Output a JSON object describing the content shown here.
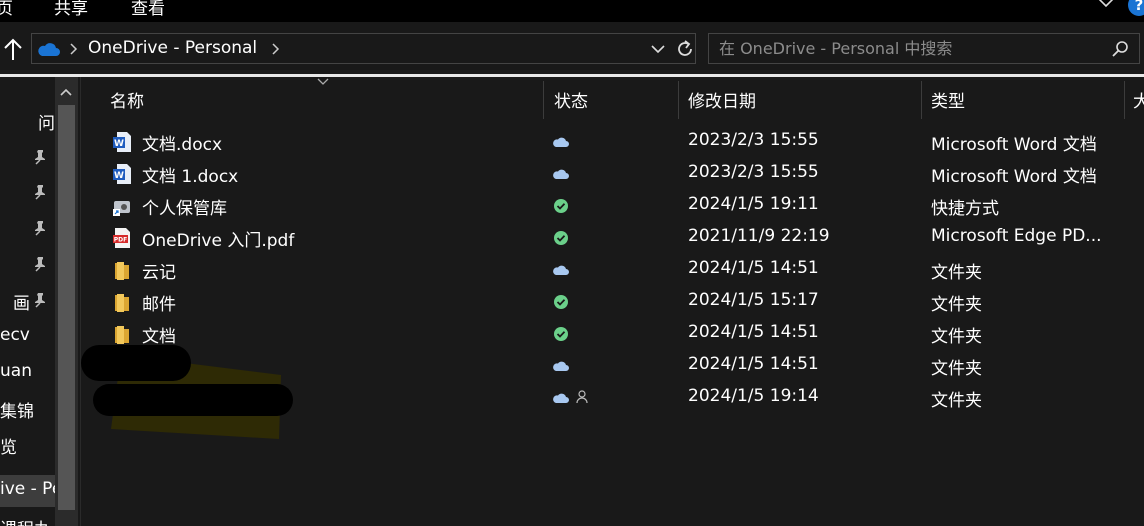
{
  "ribbon": {
    "tabs": [
      "页",
      "共享",
      "查看"
    ]
  },
  "address": {
    "path": "OneDrive - Personal",
    "search_placeholder": "在 OneDrive - Personal 中搜索"
  },
  "nav": {
    "items": [
      {
        "label": "问",
        "pinned": false
      },
      {
        "label": "",
        "pinned": true
      },
      {
        "label": "",
        "pinned": true
      },
      {
        "label": "",
        "pinned": true
      },
      {
        "label": "",
        "pinned": true
      },
      {
        "label": "画",
        "pinned": true
      },
      {
        "label": "ecv",
        "pinned": false
      },
      {
        "label": "uan",
        "pinned": false
      },
      {
        "label": "集锦",
        "pinned": false
      },
      {
        "label": "览",
        "pinned": false
      },
      {
        "label": "ive - Pe",
        "pinned": false,
        "selected": true
      },
      {
        "label": "课程丸",
        "pinned": false
      }
    ]
  },
  "columns": {
    "name": "名称",
    "status": "状态",
    "modified": "修改日期",
    "type": "类型",
    "size": "大"
  },
  "files": [
    {
      "name": "文档.docx",
      "icon": "word-doc-icon",
      "status": "cloud",
      "modified": "2023/2/3 15:55",
      "type": "Microsoft Word 文档"
    },
    {
      "name": "文档 1.docx",
      "icon": "word-doc-icon",
      "status": "cloud",
      "modified": "2023/2/3 15:55",
      "type": "Microsoft Word 文档"
    },
    {
      "name": "个人保管库",
      "icon": "shortcut-icon",
      "status": "synced",
      "modified": "2024/1/5 19:11",
      "type": "快捷方式"
    },
    {
      "name": "OneDrive 入门.pdf",
      "icon": "pdf-icon",
      "status": "synced",
      "modified": "2021/11/9 22:19",
      "type": "Microsoft Edge PD..."
    },
    {
      "name": "云记",
      "icon": "folder-icon",
      "status": "cloud",
      "modified": "2024/1/5 14:51",
      "type": "文件夹"
    },
    {
      "name": "邮件",
      "icon": "folder-icon",
      "status": "synced",
      "modified": "2024/1/5 15:17",
      "type": "文件夹"
    },
    {
      "name": "文档",
      "icon": "folder-icon",
      "status": "synced",
      "modified": "2024/1/5 14:51",
      "type": "文件夹"
    },
    {
      "name": "",
      "icon": "folder-icon",
      "status": "cloud",
      "modified": "2024/1/5 14:51",
      "type": "文件夹"
    },
    {
      "name": "",
      "icon": "folder-icon",
      "status": "cloud-shared",
      "modified": "2024/1/5 19:14",
      "type": "文件夹"
    }
  ],
  "colors": {
    "background": "#191919",
    "cloud": "#a8c8f0",
    "synced": "#6bd08a",
    "folder": "#f2c85b"
  }
}
